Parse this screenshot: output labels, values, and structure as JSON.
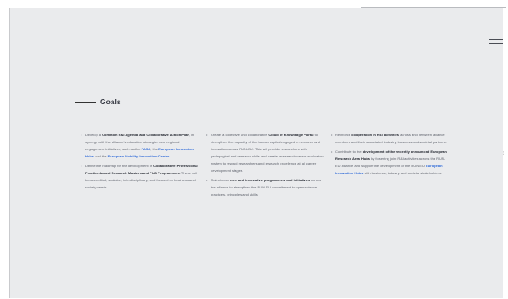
{
  "heading": "Goals",
  "columns": [
    {
      "items": [
        {
          "segments": [
            {
              "t": "Develop a ",
              "s": "n"
            },
            {
              "t": "Common R&I Agenda and Collaborative Action Plan",
              "s": "b"
            },
            {
              "t": ", in synergy with the alliance's education strategies and regional engagement initiatives, such as the ",
              "s": "n"
            },
            {
              "t": "FASA",
              "s": "l"
            },
            {
              "t": ", the ",
              "s": "n"
            },
            {
              "t": "European Innovation Hubs",
              "s": "l"
            },
            {
              "t": " and the ",
              "s": "n"
            },
            {
              "t": "European Mobility Innovation Centre",
              "s": "l"
            },
            {
              "t": ".",
              "s": "n"
            }
          ]
        },
        {
          "segments": [
            {
              "t": "Define the roadmap for the development of ",
              "s": "n"
            },
            {
              "t": "Collaborative Professional Practice-based Research Masters and PhD Programmes",
              "s": "b"
            },
            {
              "t": ". These will be accredited, scalable, interdisciplinary, and focused on business and society needs.",
              "s": "n"
            }
          ]
        }
      ]
    },
    {
      "items": [
        {
          "segments": [
            {
              "t": "Create a collective and collaborative ",
              "s": "n"
            },
            {
              "t": "Cloud of Knowledge Portal",
              "s": "b"
            },
            {
              "t": " to strengthen the capacity of the human capital engaged in research and innovation across RUN-EU. This will provide researchers with pedagogical and research skills and create a research career evaluation system to reward researchers and research excellence at all career development stages.",
              "s": "n"
            }
          ]
        },
        {
          "segments": [
            {
              "t": "Mainstream ",
              "s": "n"
            },
            {
              "t": "new and innovative programmes and initiatives",
              "s": "b"
            },
            {
              "t": " across the alliance to strengthen the RUN-EU commitment to open science practices, principles and skills.",
              "s": "n"
            }
          ]
        }
      ]
    },
    {
      "items": [
        {
          "segments": [
            {
              "t": "Reinforce ",
              "s": "n"
            },
            {
              "t": "cooperation in R&I activities",
              "s": "b"
            },
            {
              "t": " across and between alliance members and their associated industry, business and societal partners.",
              "s": "n"
            }
          ]
        },
        {
          "segments": [
            {
              "t": "Contribute to the ",
              "s": "n"
            },
            {
              "t": "development of the recently announced European Research Area Hubs",
              "s": "b"
            },
            {
              "t": " by fostering joint R&I activities across the RUN-EU alliance and support the development of the RUN-EU ",
              "s": "n"
            },
            {
              "t": "European Innovation Hubs",
              "s": "l"
            },
            {
              "t": " with business, industry and societal stakeholders.",
              "s": "n"
            }
          ]
        }
      ]
    }
  ],
  "colors": {
    "background": "#eaebed",
    "heading": "#333640",
    "body_text": "#5c606a",
    "bold_text": "#1e222b",
    "link": "#2f6ad8"
  },
  "icons": {
    "menu": "hamburger-menu-icon",
    "side": "chevron-right-icon"
  }
}
